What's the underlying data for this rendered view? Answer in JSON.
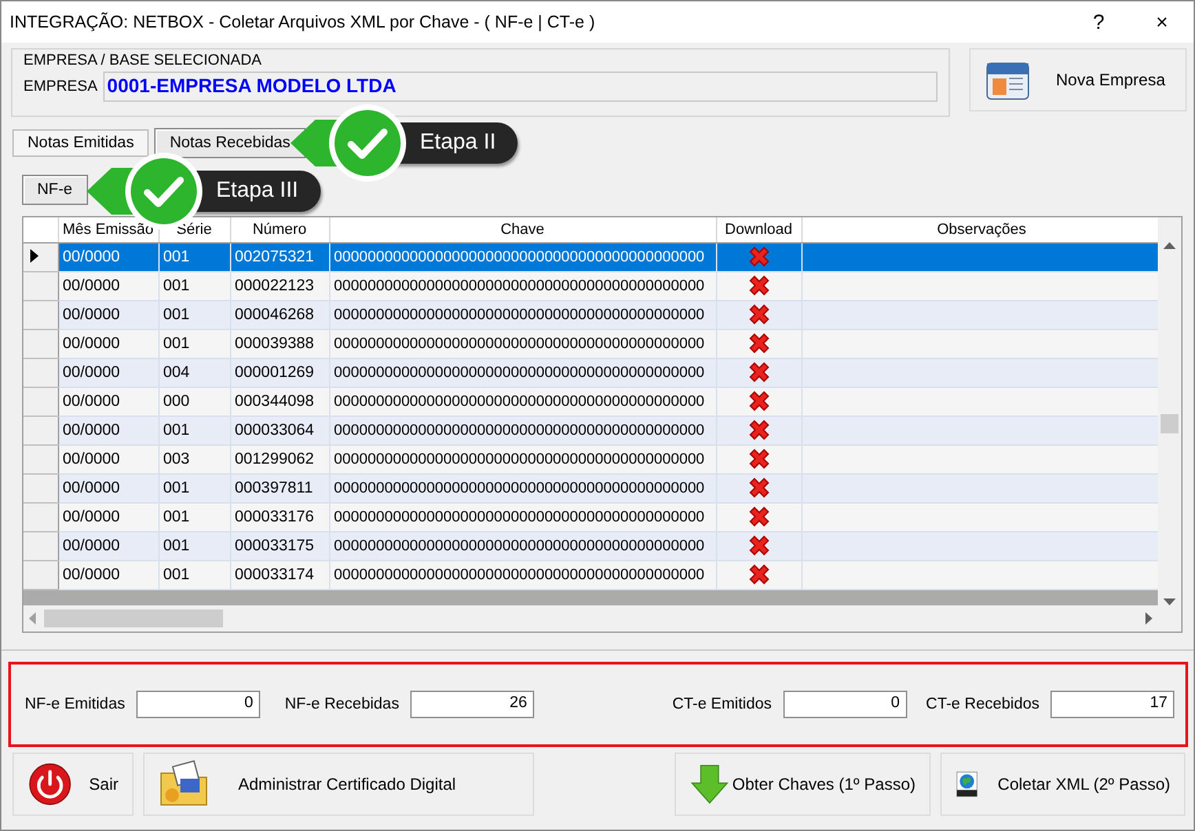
{
  "window": {
    "title": "INTEGRAÇÃO: NETBOX - Coletar Arquivos XML por Chave - ( NF-e | CT-e )",
    "help": "?",
    "close": "×"
  },
  "company": {
    "group_label": "EMPRESA  /  BASE  SELECIONADA",
    "field_label": "EMPRESA",
    "value": "0001-EMPRESA MODELO LTDA",
    "button": "Nova Empresa"
  },
  "tabs": [
    {
      "label": "Notas Emitidas",
      "selected": false
    },
    {
      "label": "Notas Recebidas",
      "selected": true
    }
  ],
  "subtabs": [
    {
      "label": "NF-e",
      "selected": true
    }
  ],
  "callouts": [
    {
      "label": "Etapa II"
    },
    {
      "label": "Etapa III"
    }
  ],
  "grid": {
    "columns": [
      "Mês Emissão",
      "Série",
      "Número",
      "Chave",
      "Download",
      "Observações"
    ],
    "rows": [
      {
        "mes": "00/0000",
        "serie": "001",
        "numero": "002075321",
        "chave": "00000000000000000000000000000000000000000000",
        "selected": true
      },
      {
        "mes": "00/0000",
        "serie": "001",
        "numero": "000022123",
        "chave": "00000000000000000000000000000000000000000000",
        "selected": false
      },
      {
        "mes": "00/0000",
        "serie": "001",
        "numero": "000046268",
        "chave": "00000000000000000000000000000000000000000000",
        "selected": false
      },
      {
        "mes": "00/0000",
        "serie": "001",
        "numero": "000039388",
        "chave": "00000000000000000000000000000000000000000000",
        "selected": false
      },
      {
        "mes": "00/0000",
        "serie": "004",
        "numero": "000001269",
        "chave": "00000000000000000000000000000000000000000000",
        "selected": false
      },
      {
        "mes": "00/0000",
        "serie": "000",
        "numero": "000344098",
        "chave": "00000000000000000000000000000000000000000000",
        "selected": false
      },
      {
        "mes": "00/0000",
        "serie": "001",
        "numero": "000033064",
        "chave": "00000000000000000000000000000000000000000000",
        "selected": false
      },
      {
        "mes": "00/0000",
        "serie": "003",
        "numero": "001299062",
        "chave": "00000000000000000000000000000000000000000000",
        "selected": false
      },
      {
        "mes": "00/0000",
        "serie": "001",
        "numero": "000397811",
        "chave": "00000000000000000000000000000000000000000000",
        "selected": false
      },
      {
        "mes": "00/0000",
        "serie": "001",
        "numero": "000033176",
        "chave": "00000000000000000000000000000000000000000000",
        "selected": false
      },
      {
        "mes": "00/0000",
        "serie": "001",
        "numero": "000033175",
        "chave": "00000000000000000000000000000000000000000000",
        "selected": false
      },
      {
        "mes": "00/0000",
        "serie": "001",
        "numero": "000033174",
        "chave": "00000000000000000000000000000000000000000000",
        "selected": false
      }
    ]
  },
  "summary": [
    {
      "label": "NF-e Emitidas",
      "value": "0"
    },
    {
      "label": "NF-e Recebidas",
      "value": "26"
    },
    {
      "label": "CT-e Emitidos",
      "value": "0"
    },
    {
      "label": "CT-e Recebidos",
      "value": "17"
    }
  ],
  "buttons": [
    {
      "label": "Sair",
      "kind": "exit"
    },
    {
      "label": "Administrar Certificado Digital",
      "kind": "certificate"
    },
    {
      "label": "Obter Chaves (1º Passo)",
      "kind": "download"
    },
    {
      "label": "Coletar XML (2º Passo)",
      "kind": "xml"
    }
  ]
}
